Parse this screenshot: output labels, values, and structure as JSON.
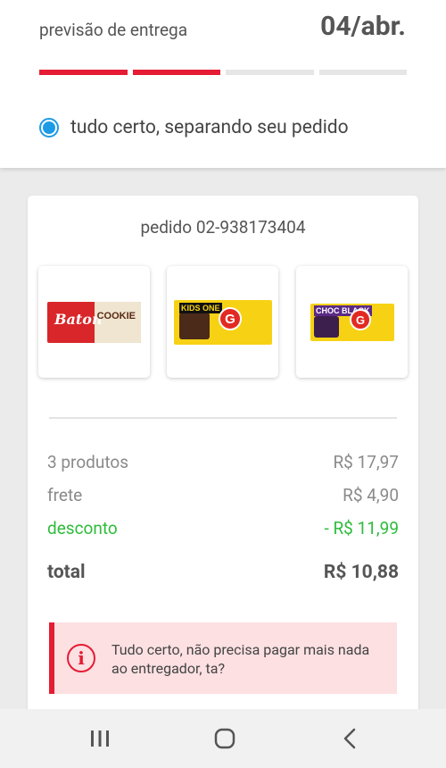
{
  "delivery": {
    "label": "previsão de entrega",
    "date": "04/abr.",
    "progress_steps_done": 2,
    "progress_steps_total": 4,
    "status_text": "tudo certo, separando seu pedido"
  },
  "order": {
    "title": "pedido 02-938173404",
    "products": [
      {
        "name": "Baton Cookie",
        "brand_mark": "Baton",
        "flavor": "COOKIE"
      },
      {
        "name": "Garoto chocolate bar",
        "brand_mark": "G",
        "flavor": "KIDS ONE"
      },
      {
        "name": "Garoto chocolate bar",
        "brand_mark": "G",
        "flavor": "CHOC BLACK"
      }
    ],
    "summary": {
      "products_label": "3 produtos",
      "products_value": "R$ 17,97",
      "shipping_label": "frete",
      "shipping_value": "R$ 4,90",
      "discount_label": "desconto",
      "discount_value": "- R$ 11,99",
      "total_label": "total",
      "total_value": "R$ 10,88"
    },
    "notice": {
      "text": "Tudo certo, não precisa pagar mais nada ao entregador, ta?",
      "icon": "info-icon"
    }
  },
  "colors": {
    "accent": "#e51c34",
    "status_blue": "#1e9be6",
    "discount_green": "#2ebc3b"
  },
  "navbar": {
    "icons": [
      "recent-apps-icon",
      "home-icon",
      "back-icon"
    ]
  }
}
